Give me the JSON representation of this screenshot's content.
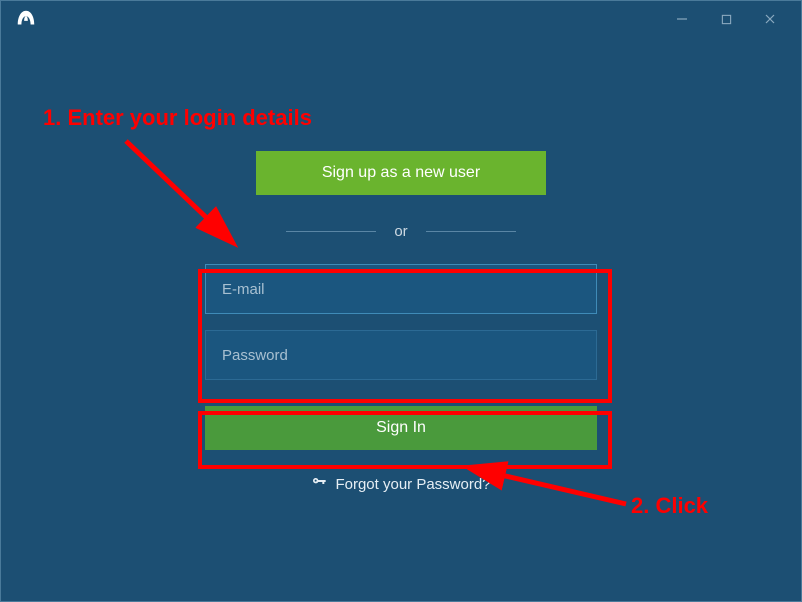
{
  "signup_label": "Sign up as a new user",
  "divider_label": "or",
  "email_placeholder": "E-mail",
  "password_placeholder": "Password",
  "signin_label": "Sign In",
  "forgot_label": "Forgot your Password?",
  "annotations": {
    "step1": "1. Enter your login details",
    "step2": "2. Click"
  }
}
